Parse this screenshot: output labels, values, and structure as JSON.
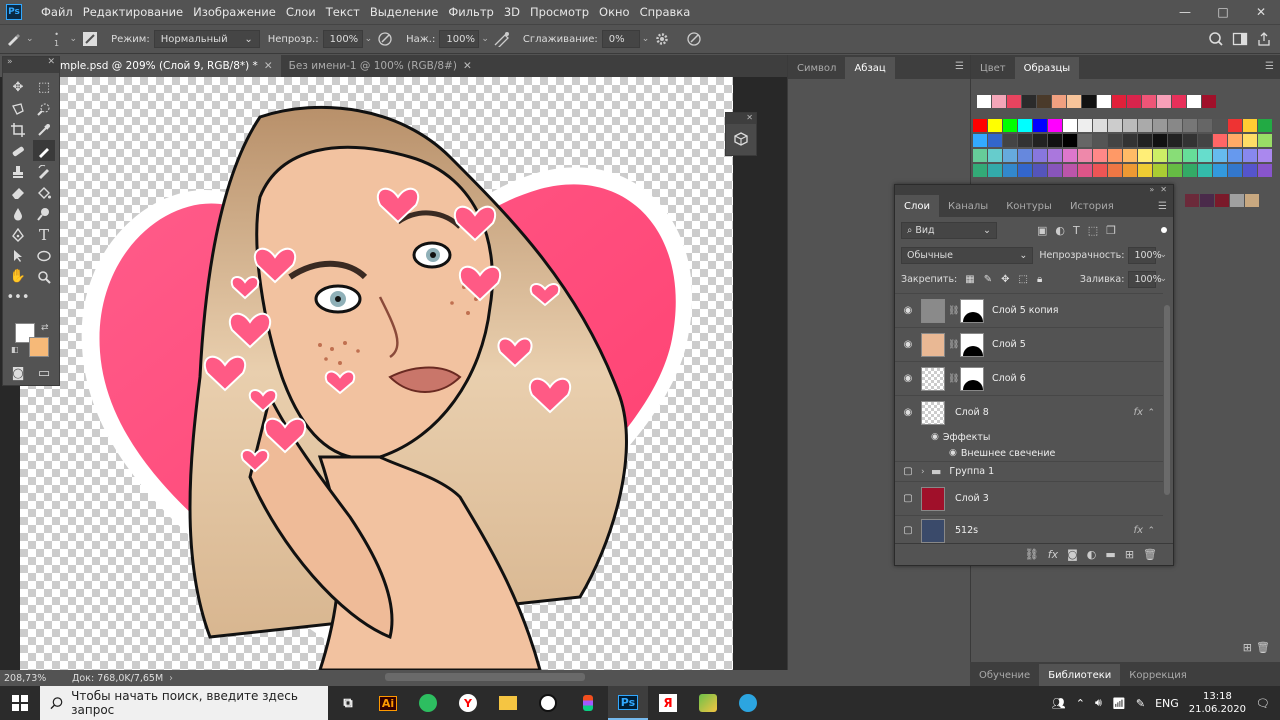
{
  "menu": [
    "Файл",
    "Редактирование",
    "Изображение",
    "Слои",
    "Текст",
    "Выделение",
    "Фильтр",
    "3D",
    "Просмотр",
    "Окно",
    "Справка"
  ],
  "app_logo": "Ps",
  "window": {
    "minimize": "—",
    "maximize": "□",
    "close": "✕"
  },
  "options": {
    "brush_size": "1",
    "mode_label": "Режим:",
    "mode_value": "Нормальный",
    "opacity_label": "Непрозр.:",
    "opacity_value": "100%",
    "pressure_label": "Наж.:",
    "pressure_value": "100%",
    "smoothing_label": "Сглаживание:",
    "smoothing_value": "0%"
  },
  "tabs": [
    {
      "label": "mple.psd @ 209% (Слой 9, RGB/8*) *",
      "close": "✕"
    },
    {
      "label": "Без имени-1 @ 100% (RGB/8#)",
      "close": "✕"
    }
  ],
  "dock_a": {
    "tabs": [
      "Символ",
      "Абзац"
    ]
  },
  "dock_b": {
    "tabs": [
      "Цвет",
      "Образцы"
    ]
  },
  "swatches": {
    "recent": [
      "#ffffff",
      "#f3a6b8",
      "#e8445f",
      "#2b2b2b",
      "#4a3a2a",
      "#f0a080",
      "#f7c49a",
      "#111111",
      "#ffffff",
      "#e0203a",
      "#d8244c",
      "#ee5577",
      "#f7a0b8",
      "#e8305a",
      "#ffffff",
      "#a0102a"
    ],
    "rows": [
      [
        "#ff0000",
        "#ffff00",
        "#00ff00",
        "#00ffff",
        "#0000ff",
        "#ff00ff",
        "#ffffff",
        "#eeeeee",
        "#dddddd",
        "#cccccc",
        "#bbbbbb",
        "#aaaaaa",
        "#999999",
        "#888888",
        "#777777",
        "#666666",
        "#555555",
        "#ee3333",
        "#ffcc33",
        "#22aa44"
      ],
      [
        "#33aaff",
        "#3366cc",
        "#444444",
        "#333333",
        "#222222",
        "#111111",
        "#000000",
        "#666666",
        "#555555",
        "#444444",
        "#333333",
        "#222222",
        "#111111",
        "#222222",
        "#333333",
        "#444444",
        "#ff6666",
        "#ffaa66",
        "#ffdd66",
        "#99dd66"
      ],
      [
        "#66cc99",
        "#66cccc",
        "#66aadd",
        "#6688dd",
        "#8877dd",
        "#aa77dd",
        "#dd77cc",
        "#ee88aa",
        "#ff8888",
        "#ff9966",
        "#ffbb66",
        "#ffee77",
        "#ccee66",
        "#88dd77",
        "#66dd99",
        "#66ddcc",
        "#66bbee",
        "#6699ee",
        "#8888ee",
        "#aa88ee"
      ],
      [
        "#33aa77",
        "#33aaaa",
        "#3388cc",
        "#3366cc",
        "#5555bb",
        "#8855bb",
        "#bb55aa",
        "#dd5588",
        "#ee5555",
        "#ee7744",
        "#ee9933",
        "#eecc33",
        "#aacc33",
        "#66bb44",
        "#33aa66",
        "#33bbaa",
        "#3399dd",
        "#3377cc",
        "#5555cc",
        "#8855cc"
      ]
    ],
    "last_row": [
      "#6b2a3a",
      "#4a2a4a",
      "#7a1a2a",
      "#a0a0a0",
      "#c8a880"
    ]
  },
  "layers": {
    "tabs": [
      "Слои",
      "Каналы",
      "Контуры",
      "История"
    ],
    "filter_label": "Вид",
    "blend_mode": "Обычные",
    "opacity_label": "Непрозрачность:",
    "opacity_value": "100%",
    "lock_label": "Закрепить:",
    "fill_label": "Заливка:",
    "fill_value": "100%",
    "items": [
      {
        "name": "Слой 5 копия",
        "visible": true
      },
      {
        "name": "Слой 5",
        "visible": true
      },
      {
        "name": "Слой 6",
        "visible": true
      },
      {
        "name": "Слой 8",
        "visible": true,
        "fx": "fx"
      },
      {
        "name": "Эффекты",
        "visible": true
      },
      {
        "name": "Внешнее свечение",
        "visible": true
      },
      {
        "name": "Группа 1",
        "visible": false
      },
      {
        "name": "Слой 3",
        "visible": false
      },
      {
        "name": "512s",
        "visible": false,
        "fx": "fx"
      }
    ]
  },
  "bottom_tabs": [
    "Обучение",
    "Библиотеки",
    "Коррекция"
  ],
  "status": {
    "zoom": "208,73%",
    "doc": "Док: 768,0K/7,65M"
  },
  "taskbar": {
    "search_placeholder": "Чтобы начать поиск, введите здесь запрос",
    "apps": [
      "Ai",
      "Ps"
    ],
    "language": "ENG",
    "time": "13:18",
    "date": "21.06.2020"
  }
}
